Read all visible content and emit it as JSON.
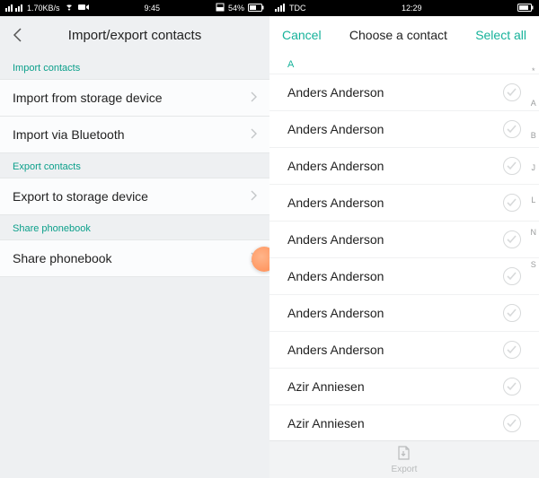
{
  "left": {
    "status": {
      "network": "1.70KB/s",
      "time": "9:45",
      "battery_pct": "54%"
    },
    "header_title": "Import/export contacts",
    "sections": [
      {
        "label": "Import contacts",
        "items": [
          "Import from storage device",
          "Import via Bluetooth"
        ]
      },
      {
        "label": "Export contacts",
        "items": [
          "Export to storage device"
        ]
      },
      {
        "label": "Share phonebook",
        "items": [
          "Share phonebook"
        ]
      }
    ]
  },
  "right": {
    "status": {
      "carrier": "TDC",
      "time": "12:29"
    },
    "header": {
      "cancel": "Cancel",
      "title": "Choose a contact",
      "select_all": "Select all"
    },
    "index_letters": [
      "A",
      "B"
    ],
    "contacts": [
      "Anders Anderson",
      "Anders Anderson",
      "Anders Anderson",
      "Anders Anderson",
      "Anders Anderson",
      "Anders Anderson",
      "Anders Anderson",
      "Anders Anderson",
      "Azir Anniesen",
      "Azir Anniesen"
    ],
    "alpha_scroll": [
      "*",
      "A",
      "B",
      "J",
      "L",
      "N",
      "S"
    ],
    "bottom_label": "Export"
  }
}
